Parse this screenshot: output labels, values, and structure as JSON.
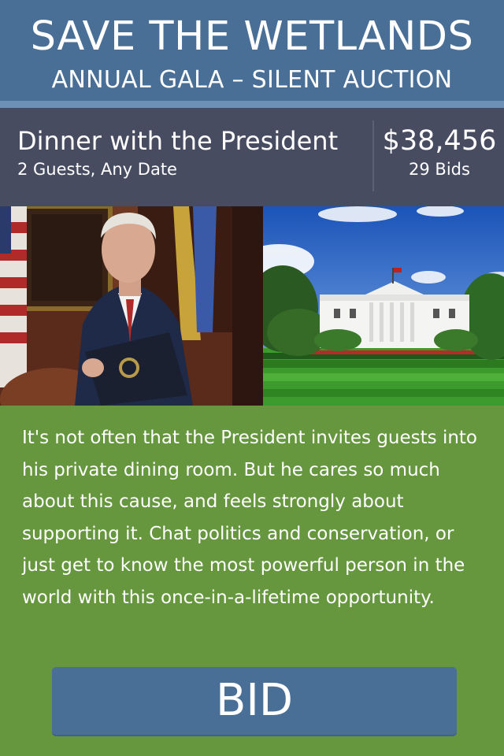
{
  "header": {
    "title": "SAVE THE WETLANDS",
    "subtitle": "ANNUAL GALA – SILENT AUCTION"
  },
  "item": {
    "name": "Dinner with the President",
    "details": "2 Guests, Any Date",
    "price": "$38,456",
    "bids": "29 Bids"
  },
  "images": {
    "left": "president-portrait",
    "right": "white-house-lawn"
  },
  "description": "It's not often that the President invites guests into his private dining room. But he cares so much about this cause, and feels strongly about supporting it. Chat politics and conservation, or just get to know the most powerful person in the world with this once-in-a-lifetime opportunity.",
  "bid_button": {
    "label": "BID"
  },
  "colors": {
    "header_bg": "#4a6f97",
    "item_bar_bg": "#474c61",
    "body_bg": "#66973f",
    "button_bg": "#4a6f97"
  }
}
